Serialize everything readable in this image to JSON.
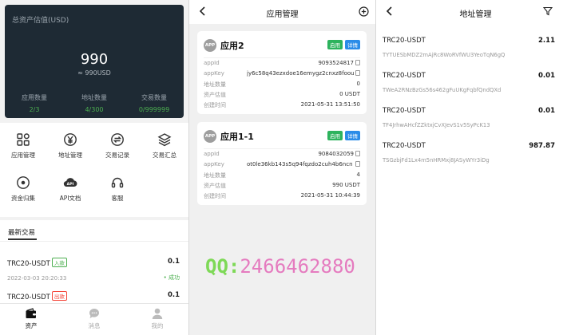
{
  "wallet": {
    "summary": {
      "label": "总资产估值(USD)",
      "value": "990",
      "approx": "≈ 990USD",
      "stats": [
        {
          "label": "应用数量",
          "value": "2/3"
        },
        {
          "label": "地址数量",
          "value": "4/300"
        },
        {
          "label": "交易数量",
          "value": "0/999999"
        }
      ]
    },
    "menu": [
      {
        "label": "应用管理",
        "icon": "grid-icon"
      },
      {
        "label": "地址管理",
        "icon": "yen-icon"
      },
      {
        "label": "交易记录",
        "icon": "exchange-icon"
      },
      {
        "label": "交易汇总",
        "icon": "layers-icon"
      },
      {
        "label": "资金归集",
        "icon": "coin-icon"
      },
      {
        "label": "API文档",
        "icon": "cloud-api-icon"
      },
      {
        "label": "客服",
        "icon": "headset-icon"
      }
    ],
    "latest": {
      "title": "最新交易",
      "items": [
        {
          "pair": "TRC20-USDT",
          "tag": "入款",
          "tag_type": "in",
          "amount": "0.1",
          "time": "2022-03-03 20:20:33",
          "status": "• 成功"
        },
        {
          "pair": "TRC20-USDT",
          "tag": "出款",
          "tag_type": "out",
          "amount": "0.1"
        }
      ]
    },
    "tabs": [
      {
        "label": "资产",
        "icon": "wallet-icon"
      },
      {
        "label": "消息",
        "icon": "chat-icon"
      },
      {
        "label": "我的",
        "icon": "user-icon"
      }
    ]
  },
  "apps": {
    "title": "应用管理",
    "enabled_label": "启用",
    "detail_label": "详情",
    "app_badge": "APP",
    "cards": [
      {
        "name": "应用2",
        "rows": [
          {
            "k": "appId",
            "v": "9093524817"
          },
          {
            "k": "appKey",
            "v": "jy6c58q43ezxdoe16emygz2cnxz8foouuo"
          },
          {
            "k": "地址数量",
            "v": "0"
          },
          {
            "k": "资产估值",
            "v": "0 USDT"
          },
          {
            "k": "创建时间",
            "v": "2021-05-31 13:51:50"
          }
        ]
      },
      {
        "name": "应用1-1",
        "rows": [
          {
            "k": "appId",
            "v": "9084032059"
          },
          {
            "k": "appKey",
            "v": "ot0le36kb143s5q94fqzdo2cuh4b6ncn"
          },
          {
            "k": "地址数量",
            "v": "4"
          },
          {
            "k": "资产估值",
            "v": "990 USDT"
          },
          {
            "k": "创建时间",
            "v": "2021-05-31 10:44:39"
          }
        ]
      }
    ],
    "watermark_prefix": "QQ:",
    "watermark_number": "2466462880"
  },
  "addresses": {
    "title": "地址管理",
    "items": [
      {
        "name": "TRC20-USDT",
        "amount": "2.11",
        "address": "TYTUESbMDZ2mAjRc8WoRVfWU3YeoTqN6gQ"
      },
      {
        "name": "TRC20-USDT",
        "amount": "0.01",
        "address": "TWeA2RNzBzGs56s462gFuUKgFqbfQndQXd"
      },
      {
        "name": "TRC20-USDT",
        "amount": "0.01",
        "address": "TF4JrhwAHcfZZktxjCvXJevS1v5SyPcK13"
      },
      {
        "name": "TRC20-USDT",
        "amount": "987.87",
        "address": "TSGzbjFd1Lx4m5nHRMxj8JASyWYr3iDg"
      }
    ]
  }
}
